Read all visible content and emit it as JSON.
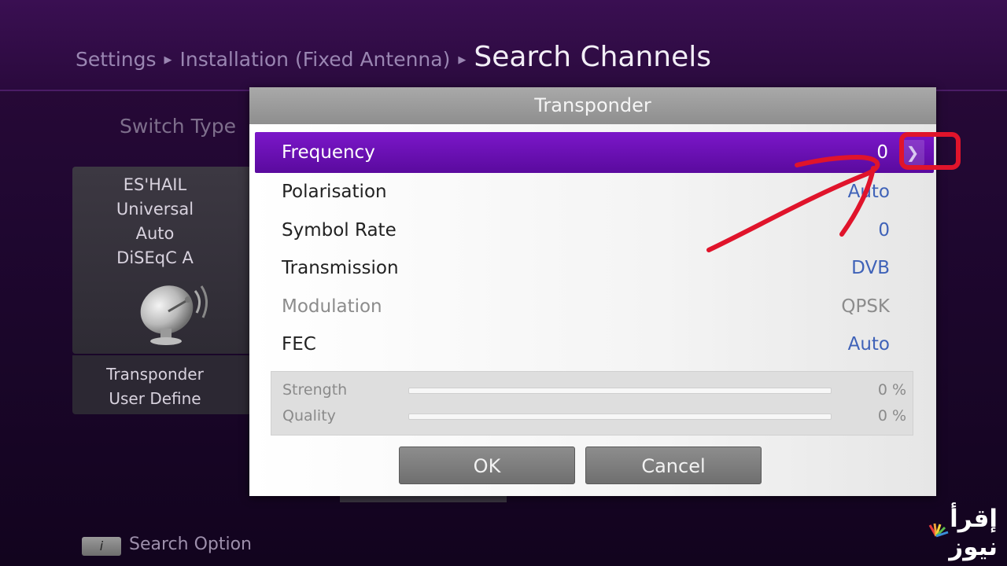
{
  "header": {
    "breadcrumb": [
      "Settings",
      "Installation (Fixed Antenna)"
    ],
    "title": "Search Channels"
  },
  "background": {
    "switch_type_label": "Switch Type",
    "satellite_card": {
      "lines": [
        "ES'HAIL",
        "Universal",
        "Auto",
        "DiSEqC A"
      ],
      "icon": "satellite-dish-icon"
    },
    "transponder_card": {
      "lines": [
        "Transponder",
        "User Define"
      ]
    }
  },
  "dialog": {
    "title": "Transponder",
    "rows": [
      {
        "label": "Frequency",
        "value": "0",
        "selected": true
      },
      {
        "label": "Polarisation",
        "value": "Auto"
      },
      {
        "label": "Symbol Rate",
        "value": "0"
      },
      {
        "label": "Transmission",
        "value": "DVB"
      },
      {
        "label": "Modulation",
        "value": "QPSK",
        "disabled": true
      },
      {
        "label": "FEC",
        "value": "Auto"
      }
    ],
    "arrow_icon": "chevron-right-icon",
    "signal": {
      "strength": {
        "label": "Strength",
        "value": "0 %",
        "level_percent": 0
      },
      "quality": {
        "label": "Quality",
        "value": "0 %",
        "level_percent": 0
      }
    },
    "buttons": {
      "ok": "OK",
      "cancel": "Cancel"
    }
  },
  "footer": {
    "info_key": "i",
    "label": "Search Option"
  },
  "watermark": {
    "text": "إقرأ نيوز"
  },
  "colors": {
    "accent": "#6a10b4",
    "value_blue": "#3f62b8",
    "annotation_red": "#e0142b"
  }
}
